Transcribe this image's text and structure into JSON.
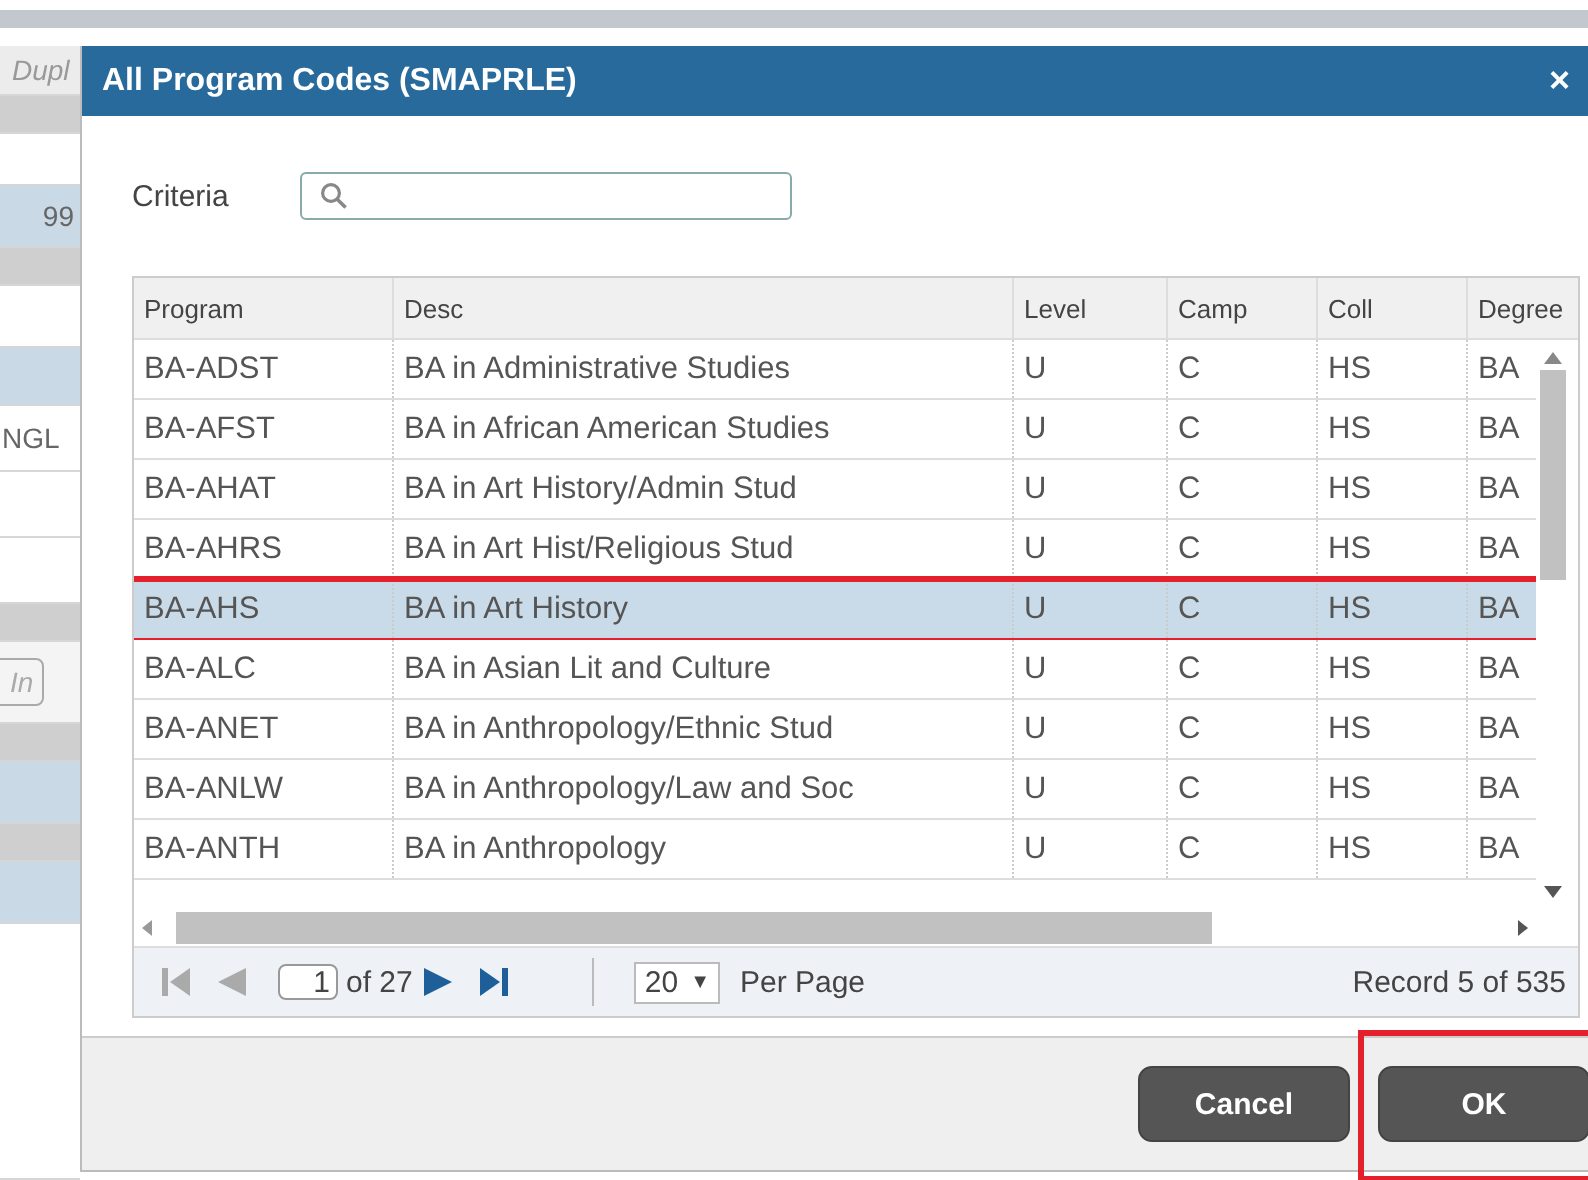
{
  "background": [
    {
      "kind": "italic",
      "text": "Dupl"
    },
    {
      "kind": "band"
    },
    {
      "kind": "label"
    },
    {
      "kind": "value",
      "text": "99"
    },
    {
      "kind": "band"
    },
    {
      "kind": "blank"
    },
    {
      "kind": "tab"
    },
    {
      "kind": "field",
      "text": "NGL"
    },
    {
      "kind": "field"
    },
    {
      "kind": "field"
    },
    {
      "kind": "band"
    },
    {
      "kind": "button",
      "text": "In"
    },
    {
      "kind": "band"
    },
    {
      "kind": "value"
    },
    {
      "kind": "band"
    },
    {
      "kind": "value"
    },
    {
      "kind": "blank"
    }
  ],
  "dialog": {
    "title": "All Program Codes (SMAPRLE)",
    "close": "×",
    "criteria": {
      "label": "Criteria"
    },
    "grid": {
      "columns": [
        "Program",
        "Desc",
        "Level",
        "Camp",
        "Coll",
        "Degree"
      ],
      "rows": [
        {
          "cells": [
            "BA-ADST",
            "BA in Administrative Studies",
            "U",
            "C",
            "HS",
            "BA"
          ],
          "selected": false,
          "annotated": false
        },
        {
          "cells": [
            "BA-AFST",
            "BA in African American Studies",
            "U",
            "C",
            "HS",
            "BA"
          ],
          "selected": false,
          "annotated": false
        },
        {
          "cells": [
            "BA-AHAT",
            "BA in Art History/Admin Stud",
            "U",
            "C",
            "HS",
            "BA"
          ],
          "selected": false,
          "annotated": false
        },
        {
          "cells": [
            "BA-AHRS",
            "BA in Art Hist/Religious Stud",
            "U",
            "C",
            "HS",
            "BA"
          ],
          "selected": false,
          "annotated": false
        },
        {
          "cells": [
            "BA-AHS",
            "BA in Art History",
            "U",
            "C",
            "HS",
            "BA"
          ],
          "selected": true,
          "annotated": true
        },
        {
          "cells": [
            "BA-ALC",
            "BA in Asian Lit and Culture",
            "U",
            "C",
            "HS",
            "BA"
          ],
          "selected": false,
          "annotated": false
        },
        {
          "cells": [
            "BA-ANET",
            "BA in Anthropology/Ethnic Stud",
            "U",
            "C",
            "HS",
            "BA"
          ],
          "selected": false,
          "annotated": false
        },
        {
          "cells": [
            "BA-ANLW",
            "BA in Anthropology/Law and Soc",
            "U",
            "C",
            "HS",
            "BA"
          ],
          "selected": false,
          "annotated": false
        },
        {
          "cells": [
            "BA-ANTH",
            "BA in Anthropology",
            "U",
            "C",
            "HS",
            "BA"
          ],
          "selected": false,
          "annotated": false
        }
      ],
      "pager": {
        "page": "1",
        "of": "of 27",
        "per_page": "20",
        "caret": "▼",
        "per_page_label": "Per Page",
        "record": "Record 5 of 535"
      }
    },
    "buttons": [
      {
        "label": "Cancel",
        "annotated": false
      },
      {
        "label": "OK",
        "annotated": true
      }
    ]
  }
}
